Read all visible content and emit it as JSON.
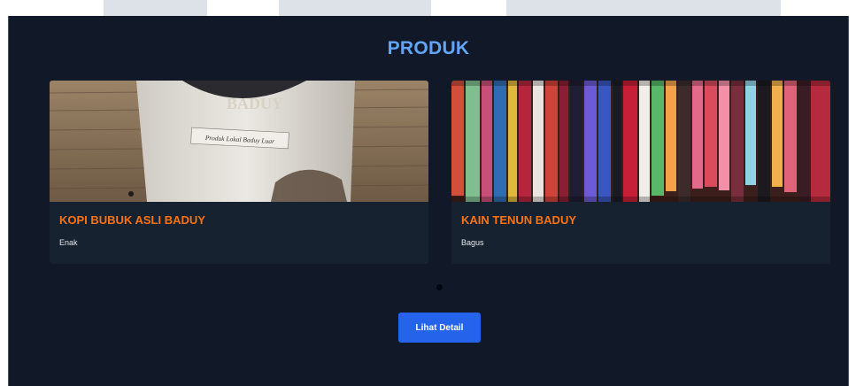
{
  "section": {
    "title": "PRODUK"
  },
  "products": [
    {
      "title": "KOPI BUBUK ASLI BADUY",
      "description": "Enak",
      "image": "coffee-package-photo",
      "package_text_top": "BADUY",
      "package_text_label": "Produk Lokal Baduy Luar"
    },
    {
      "title": "KAIN TENUN BADUY",
      "description": "Bagus",
      "image": "woven-cloth-photo"
    }
  ],
  "carousel": {
    "active_index": 0,
    "indicator_count": 1
  },
  "detail_button": {
    "label": "Lihat Detail"
  },
  "colors": {
    "background": "#111827",
    "card": "#172231",
    "title": "#60a5fa",
    "product_title": "#f97316",
    "button": "#2563eb"
  }
}
